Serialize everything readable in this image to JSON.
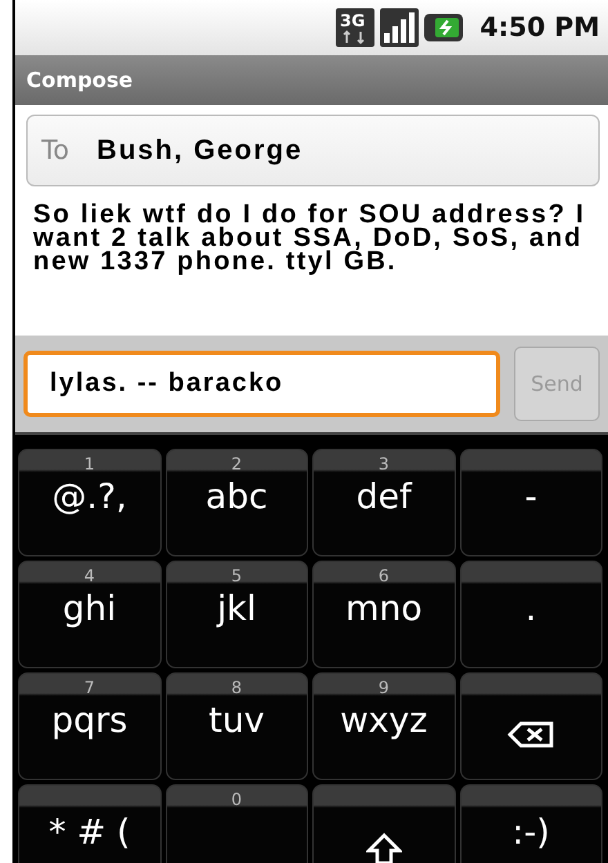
{
  "status_bar": {
    "time": "4:50 PM",
    "network": "3G"
  },
  "title": "Compose",
  "to_field": {
    "label": "To",
    "value": "Bush, George"
  },
  "message": "So liek wtf do I do for SOU address? I want 2 talk about SSA, DoD, SoS, and new 1337 phone. ttyl GB.",
  "compose": {
    "value": "lylas. -- baracko",
    "send": "Send",
    "send_disabled": true,
    "focused": true
  },
  "keyboard": [
    {
      "kind": "text",
      "digit": "1",
      "label": "@.?,"
    },
    {
      "kind": "text",
      "digit": "2",
      "label": "abc"
    },
    {
      "kind": "text",
      "digit": "3",
      "label": "def"
    },
    {
      "kind": "text",
      "label": "-"
    },
    {
      "kind": "text",
      "digit": "4",
      "label": "ghi"
    },
    {
      "kind": "text",
      "digit": "5",
      "label": "jkl"
    },
    {
      "kind": "text",
      "digit": "6",
      "label": "mno"
    },
    {
      "kind": "text",
      "label": "."
    },
    {
      "kind": "text",
      "digit": "7",
      "label": "pqrs"
    },
    {
      "kind": "text",
      "digit": "8",
      "label": "tuv"
    },
    {
      "kind": "text",
      "digit": "9",
      "label": "wxyz"
    },
    {
      "kind": "backspace"
    },
    {
      "kind": "text",
      "label": "* # ("
    },
    {
      "kind": "space",
      "digit": "0"
    },
    {
      "kind": "shift"
    },
    {
      "kind": "text",
      "label": ":-)"
    }
  ]
}
